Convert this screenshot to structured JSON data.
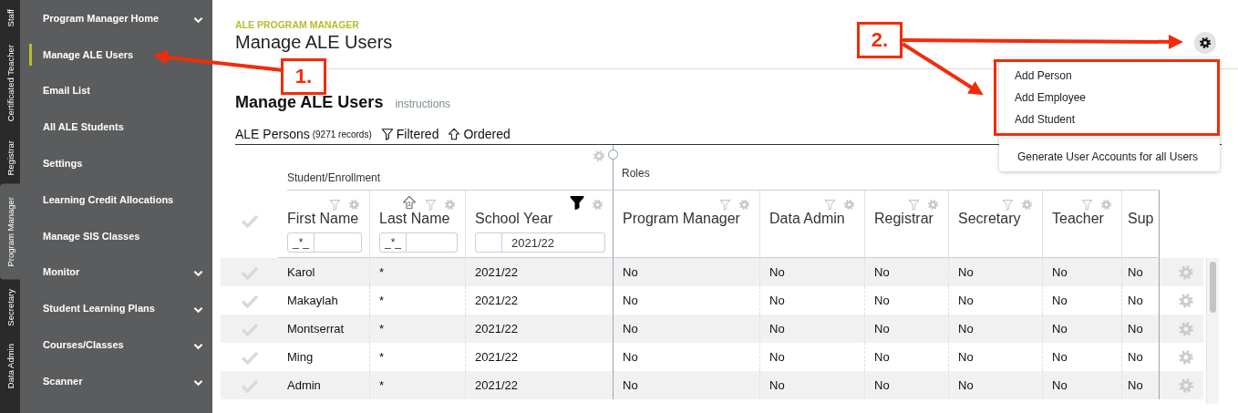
{
  "rail_tabs": [
    {
      "label": "Staff",
      "selected": false
    },
    {
      "label": "Certificated Teacher",
      "selected": false
    },
    {
      "label": "Registrar",
      "selected": false
    },
    {
      "label": "Program Manager",
      "selected": true
    },
    {
      "label": "Secretary",
      "selected": false
    },
    {
      "label": "Data Admin",
      "selected": false
    }
  ],
  "sidebar": {
    "items": [
      {
        "label": "Program Manager Home",
        "expandable": true,
        "selected": false
      },
      {
        "label": "Manage ALE Users",
        "expandable": false,
        "selected": true
      },
      {
        "label": "Email List",
        "expandable": false,
        "selected": false
      },
      {
        "label": "All ALE Students",
        "expandable": false,
        "selected": false
      },
      {
        "label": "Settings",
        "expandable": false,
        "selected": false
      },
      {
        "label": "Learning Credit Allocations",
        "expandable": false,
        "selected": false
      },
      {
        "label": "Manage SIS Classes",
        "expandable": false,
        "selected": false
      },
      {
        "label": "Monitor",
        "expandable": true,
        "selected": false
      },
      {
        "label": "Student Learning Plans",
        "expandable": true,
        "selected": false
      },
      {
        "label": "Courses/Classes",
        "expandable": true,
        "selected": false
      },
      {
        "label": "Scanner",
        "expandable": true,
        "selected": false
      }
    ]
  },
  "header": {
    "eyebrow": "ALE PROGRAM MANAGER",
    "title": "Manage ALE Users"
  },
  "section": {
    "title": "Manage ALE Users",
    "link": "instructions"
  },
  "toolbar": {
    "label": "ALE Persons",
    "count": "(9271 records)",
    "filtered": "Filtered",
    "ordered": "Ordered"
  },
  "menu": {
    "items": [
      {
        "label": "Add Person",
        "annotated": true
      },
      {
        "label": "Add Employee",
        "annotated": true
      },
      {
        "label": "Add Student",
        "annotated": true
      },
      {
        "label": "Generate User Accounts for all Users",
        "annotated": false
      }
    ]
  },
  "annotations": [
    {
      "label": "1."
    },
    {
      "label": "2."
    }
  ],
  "table": {
    "groups": [
      {
        "label": "Student/Enrollment"
      },
      {
        "label": "Roles"
      }
    ],
    "columns": [
      {
        "label": "First Name",
        "filter_active": false,
        "filter": {
          "operator": "_*_"
        }
      },
      {
        "label": "Last Name",
        "filter_active": false,
        "sort_rank": "1",
        "filter": {
          "operator": "_*_"
        }
      },
      {
        "label": "School Year",
        "filter_active": true,
        "filter": {
          "value": "2021/22"
        }
      },
      {
        "label": "Program Manager",
        "filter_active": false
      },
      {
        "label": "Data Admin",
        "filter_active": false
      },
      {
        "label": "Registrar",
        "filter_active": false
      },
      {
        "label": "Secretary",
        "filter_active": false
      },
      {
        "label": "Teacher",
        "filter_active": false
      },
      {
        "label": "Sup"
      }
    ],
    "rows": [
      {
        "cells": [
          "Karol",
          "*",
          "2021/22",
          "No",
          "No",
          "No",
          "No",
          "No",
          "No"
        ]
      },
      {
        "cells": [
          "Makaylah",
          "*",
          "2021/22",
          "No",
          "No",
          "No",
          "No",
          "No",
          "No"
        ]
      },
      {
        "cells": [
          "Montserrat",
          "*",
          "2021/22",
          "No",
          "No",
          "No",
          "No",
          "No",
          "No"
        ]
      },
      {
        "cells": [
          "Ming",
          "*",
          "2021/22",
          "No",
          "No",
          "No",
          "No",
          "No",
          "No"
        ]
      },
      {
        "cells": [
          "Admin",
          "*",
          "2021/22",
          "No",
          "No",
          "No",
          "No",
          "No",
          "No"
        ]
      }
    ]
  }
}
